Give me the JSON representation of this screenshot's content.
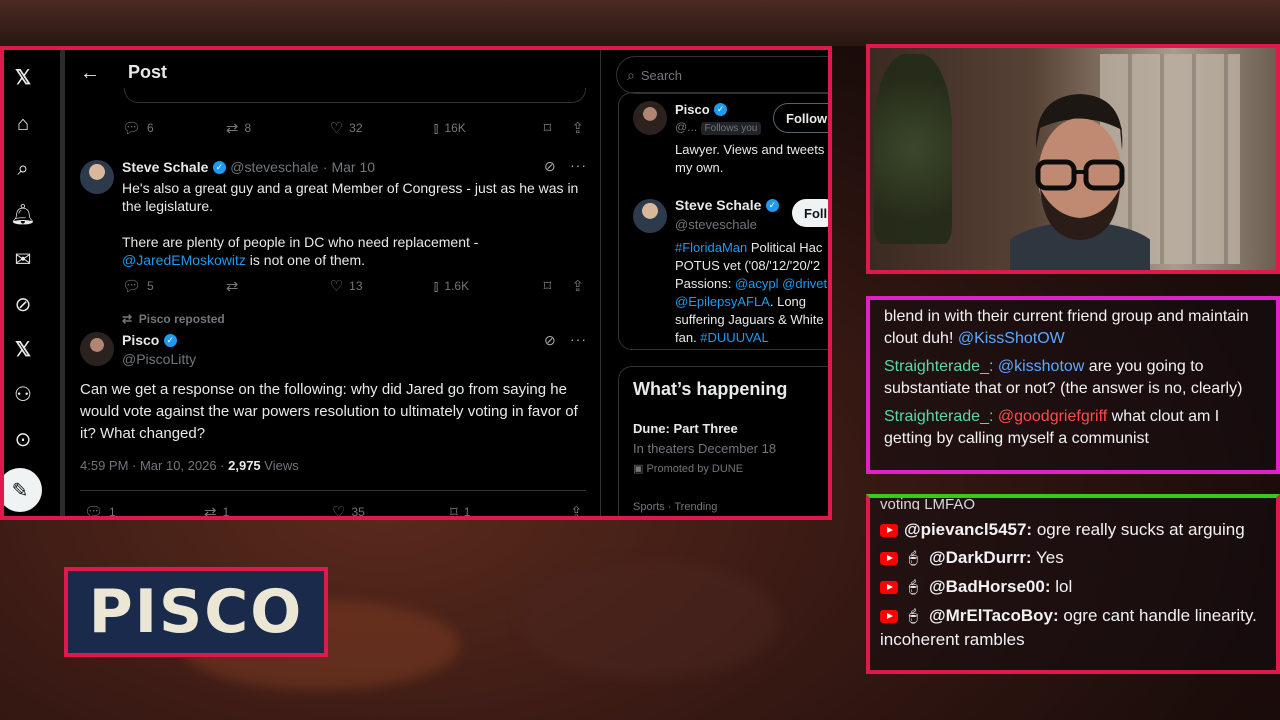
{
  "x": {
    "header": {
      "title": "Post"
    },
    "thread_stats": {
      "replies": "6",
      "reposts": "8",
      "likes": "32",
      "views": "16K"
    },
    "reply": {
      "name": "Steve Schale",
      "handle": "@steveschale",
      "date": "· Mar 10",
      "text1": "He's also a great guy and a great Member of Congress - just as he was in the legislature.",
      "text2a": "There are plenty of people in DC who need replacement -",
      "mention": "@JaredEMoskowitz",
      "text2b": " is not one of them.",
      "stats": {
        "replies": "5",
        "reposts": "",
        "likes": "13",
        "views": "1.6K"
      }
    },
    "main_post": {
      "repost_note": "Pisco reposted",
      "name": "Pisco",
      "handle": "@PiscoLitty",
      "text": "Can we get a response on the following: why did Jared go from saying he would vote against the war powers resolution to ultimately voting in favor of it? What changed?",
      "time": "4:59 PM · Mar 10, 2026 · ",
      "views_count": "2,975",
      "views_label": " Views",
      "stats": {
        "replies": "1",
        "reposts": "1",
        "likes": "35",
        "bookmarks": "1"
      }
    },
    "sidebar": {
      "search_placeholder": "Search",
      "profile1": {
        "name": "Pisco",
        "handle": "@...",
        "follows_you": "Follows you",
        "bio": "Lawyer. Views and tweets my own.",
        "follow": "Followi"
      },
      "profile2": {
        "name": "Steve Schale",
        "handle": "@steveschale",
        "follow": "Foll",
        "bio_tag": "#FloridaMan",
        "bio1": " Political Hac",
        "bio2": "POTUS vet ('08/'12/'20/'2",
        "bio3": "Passions: ",
        "bio_m1": "@acypl",
        "bio_m2": " @drivet",
        "bio_m3": "@EpilepsyAFLA",
        "bio4": ". Long",
        "bio5": "suffering Jaguars & White",
        "bio6": "fan. ",
        "bio_tag2": "#DUUUVAL"
      },
      "happening": {
        "title": "What’s happening",
        "item1_title": "Dune: Part Three",
        "item1_sub": "In theaters December 18",
        "item1_promo": "Promoted by DUNE",
        "item2_cat": "Sports · Trending"
      }
    }
  },
  "chat_top": {
    "line1": "blend in with their current friend group and maintain clout duh! ",
    "line1_mention": "@KissShotOW",
    "line2_user": "Straighterade_:",
    "line2_mention": " @kisshotow",
    "line2_text": " are you going to substantiate that or not? (the answer is no, clearly)",
    "line3_user": "Straighterade_:",
    "line3_mention": " @goodgriefgriff",
    "line3_text": " what clout am I getting by calling myself a communist"
  },
  "chat_bottom": {
    "partial": "voting LMFAO",
    "messages": [
      {
        "user": "@pievancl5457:",
        "text": " ogre really sucks at arguing"
      },
      {
        "user": "@DarkDurrr:",
        "text": " Yes"
      },
      {
        "user": "@BadHorse00:",
        "text": " lol"
      },
      {
        "user": "@MrElTacoBoy:",
        "text": " ogre cant handle linearity. incoherent rambles"
      }
    ]
  },
  "nameplate": "PISCO",
  "colors": {
    "frame_red": "#e0194d",
    "frame_pink": "#e020c8",
    "frame_green": "#39c91a",
    "x_blue": "#1d9bf0"
  }
}
